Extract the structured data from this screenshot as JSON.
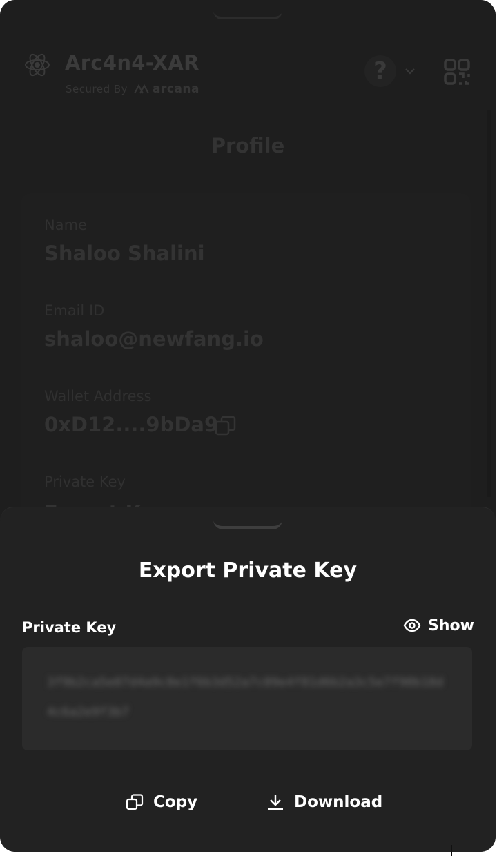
{
  "header": {
    "app_name": "Arc4n4-XAR",
    "secured_by": "Secured By",
    "brand": "arcana",
    "help_glyph": "?"
  },
  "profile": {
    "title": "Profile",
    "name_label": "Name",
    "name_value": "Shaloo Shalini",
    "email_label": "Email ID",
    "email_value": "shaloo@newfang.io",
    "wallet_label": "Wallet Address",
    "wallet_value": "0xD12....9bDa9",
    "private_key_label": "Private Key",
    "private_key_partial": "Export Key"
  },
  "export_sheet": {
    "title": "Export Private Key",
    "field_label": "Private Key",
    "show_label": "Show",
    "masked_key": "3f9b2ca5e07d4a9c8e1f6b3d52a7c09e4f81d6b2a3c5e7f90b18d4c6a2e9f3b7",
    "copy_label": "Copy",
    "download_label": "Download"
  },
  "icons": {
    "logo": "react-atom-icon",
    "help": "help-icon",
    "chevron": "chevron-down-icon",
    "qr": "qr-code-icon",
    "copy": "copy-icon",
    "show": "eye-icon",
    "download": "download-icon"
  },
  "colors": {
    "sheet_bg": "#222222",
    "overlay_bg": "#1c1c1c",
    "key_box_bg": "#2b2b2b",
    "text_primary": "#ffffff"
  }
}
